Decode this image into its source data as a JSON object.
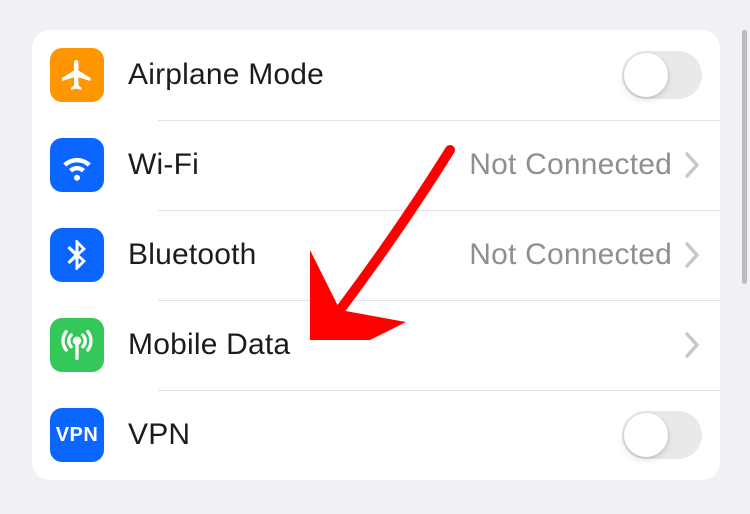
{
  "items": [
    {
      "label": "Airplane Mode",
      "status": "",
      "accessory": "toggle",
      "toggle_on": false,
      "icon": "airplane-icon",
      "icon_bg": "bg-orange"
    },
    {
      "label": "Wi-Fi",
      "status": "Not Connected",
      "accessory": "chevron",
      "icon": "wifi-icon",
      "icon_bg": "bg-blue"
    },
    {
      "label": "Bluetooth",
      "status": "Not Connected",
      "accessory": "chevron",
      "icon": "bluetooth-icon",
      "icon_bg": "bg-blue2"
    },
    {
      "label": "Mobile Data",
      "status": "",
      "accessory": "chevron",
      "icon": "antenna-icon",
      "icon_bg": "bg-green"
    },
    {
      "label": "VPN",
      "status": "",
      "accessory": "toggle",
      "toggle_on": false,
      "icon": "vpn-icon",
      "icon_bg": "bg-vpn"
    }
  ],
  "vpn_icon_text": "VPN",
  "annotation": {
    "type": "arrow",
    "color": "#ff0000",
    "target": "Mobile Data"
  }
}
